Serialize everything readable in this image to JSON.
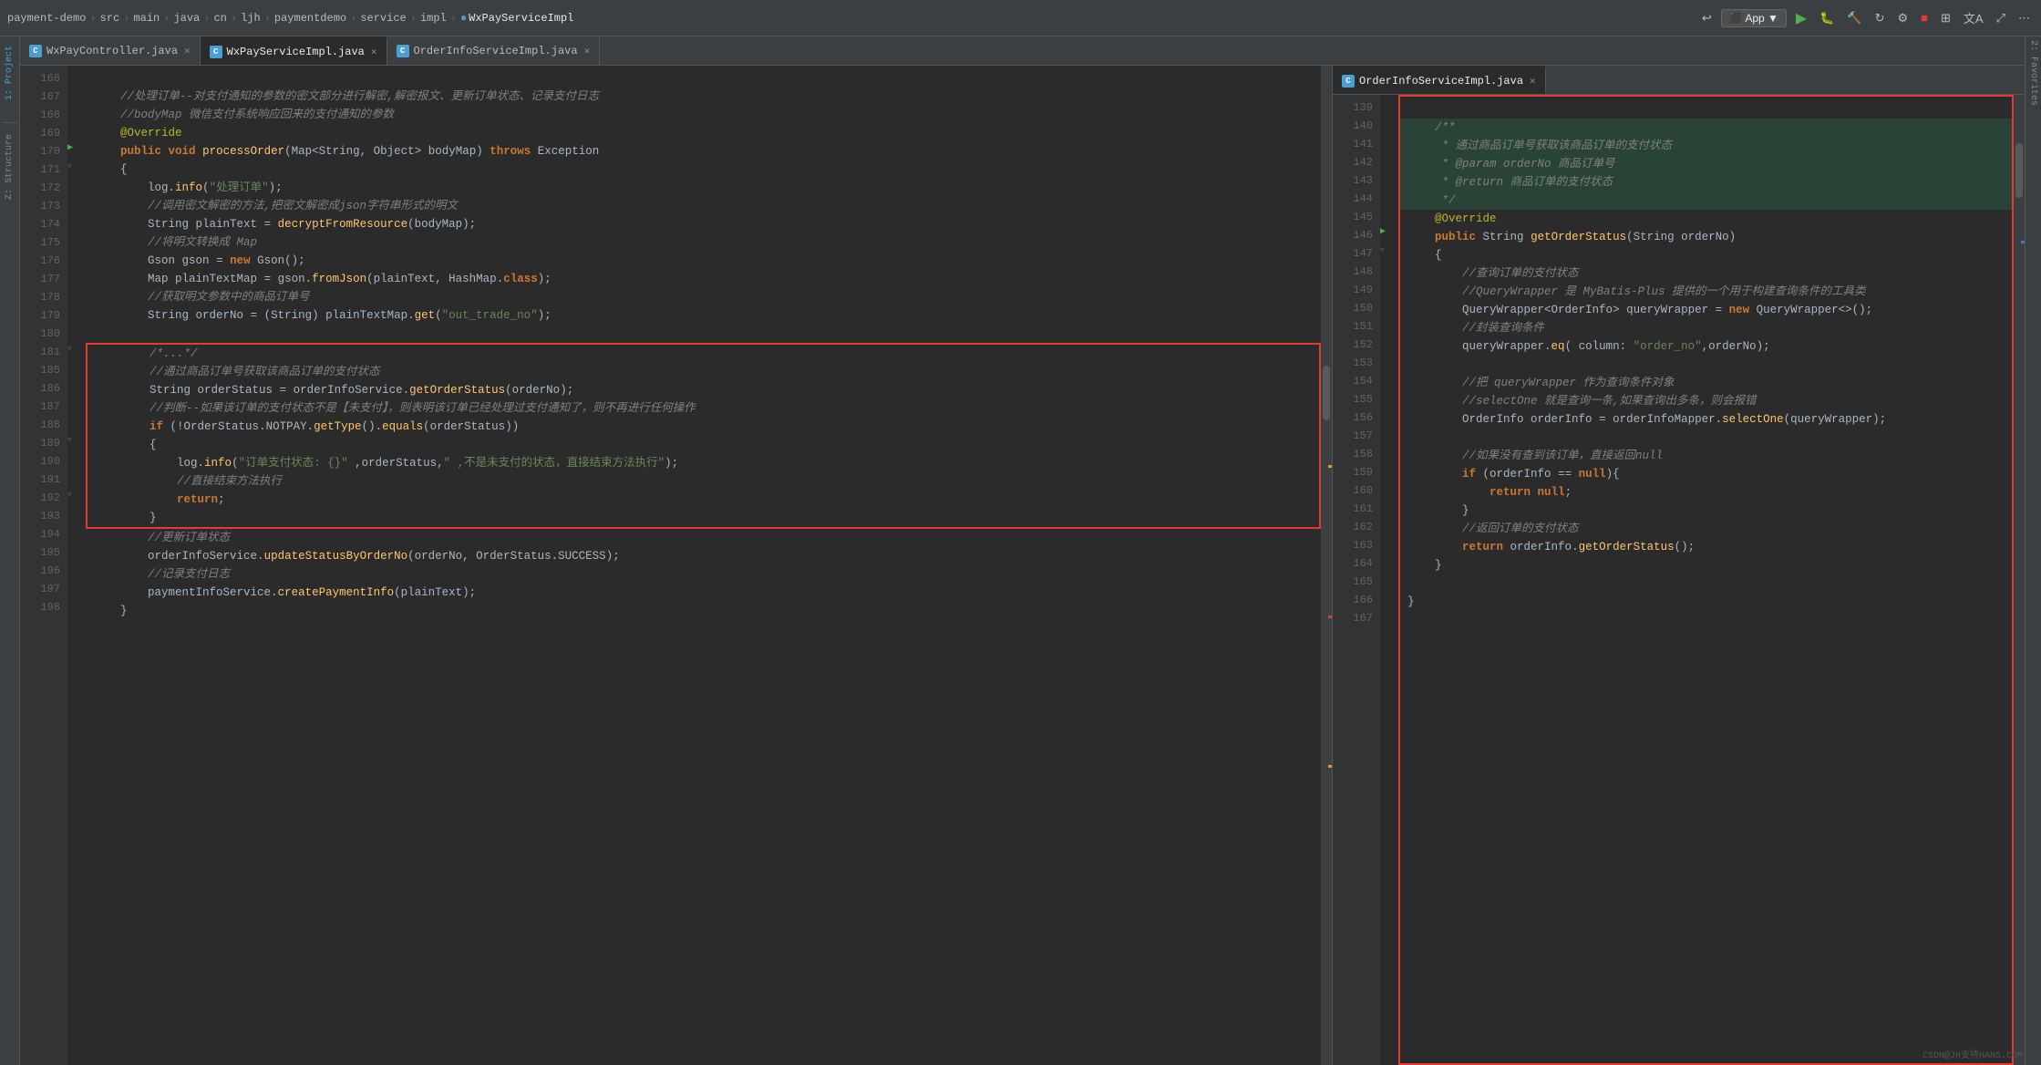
{
  "titleBar": {
    "breadcrumb": [
      "payment-demo",
      "src",
      "main",
      "java",
      "cn",
      "ljh",
      "paymentdemo",
      "service",
      "impl",
      "WxPayServiceImpl"
    ],
    "appLabel": "App",
    "buttons": [
      "run",
      "debug",
      "build",
      "reload",
      "settings",
      "stop",
      "structure",
      "translate",
      "expand",
      "settings2"
    ]
  },
  "leftTabs": [
    {
      "label": "WxPayController.java",
      "active": false
    },
    {
      "label": "WxPayServiceImpl.java",
      "active": true
    },
    {
      "label": "OrderInfoServiceImpl.java",
      "active": false
    }
  ],
  "rightTabs": [
    {
      "label": "OrderInfoServiceImpl.java",
      "active": true
    }
  ],
  "leftCode": {
    "startLine": 166,
    "lines": [
      {
        "n": 166,
        "content": ""
      },
      {
        "n": 167,
        "content": "    <cm>//处理订单--对支付通知的参数的密文部分进行解密,解密报文、更新订单状态、记录支付日志</cm>",
        "comment": true
      },
      {
        "n": 168,
        "content": "    <cm>//bodyMap 微信支付系统响应回来的支付通知的参数</cm>",
        "comment": true
      },
      {
        "n": 169,
        "content": "    <ann>@Override</ann>"
      },
      {
        "n": 170,
        "content": "    <kw>public</kw> <kw>void</kw> <fn>processOrder</fn>(<cls>Map</cls>&lt;<cls>String</cls>, <cls>Object</cls>&gt; <var>bodyMap</var>) <kw>throws</kw> <cls>Exception</cls>",
        "hasIcon": true
      },
      {
        "n": 171,
        "content": "    {"
      },
      {
        "n": 172,
        "content": "        <fn>log</fn>.<fn>info</fn>(<str>\"处理订单\"</str>);"
      },
      {
        "n": 173,
        "content": "        <cm>//调用密文解密的方法,把密文解密成json字符串形式的明文</cm>",
        "comment": true
      },
      {
        "n": 174,
        "content": "        <cls>String</cls> <var>plainText</var> = <fn>decryptFromResource</fn>(<var>bodyMap</var>);"
      },
      {
        "n": 175,
        "content": "        <cm>//将明文转换成 Map</cm>",
        "comment": true
      },
      {
        "n": 176,
        "content": "        <cls>Gson</cls> <var>gson</var> = <kw>new</kw> <cls>Gson</cls>();"
      },
      {
        "n": 177,
        "content": "        <cls>Map</cls> <var>plainTextMap</var> = <var>gson</var>.<fn>fromJson</fn>(<var>plainText</var>, <cls>HashMap</cls>.<kw>class</kw>);"
      },
      {
        "n": 178,
        "content": "        <cm>//获取明文参数中的商品订单号</cm>",
        "comment": true
      },
      {
        "n": 179,
        "content": "        <cls>String</cls> <var>orderNo</var> = (<cls>String</cls>) <var>plainTextMap</var>.<fn>get</fn>(<str>\"out_trade_no\"</str>);"
      },
      {
        "n": 180,
        "content": ""
      }
    ]
  },
  "leftCodeBox": {
    "lines": [
      {
        "n": 181,
        "content": "        <cm>/*...*/</cm>"
      },
      {
        "n": 185,
        "content": "        <cm>//通过商品订单号获取该商品订单的支付状态</cm>"
      },
      {
        "n": 186,
        "content": "        <cls>String</cls> <var>orderStatus</var> = <var>orderInfoService</var>.<fn>getOrderStatus</fn>(<var>orderNo</var>);"
      },
      {
        "n": 187,
        "content": "        <cm>//判断--如果该订单的支付状态不是【未支付】,则表明该订单已经处理过支付通知了,则不再进行任何操作</cm>"
      },
      {
        "n": 188,
        "content": "        <kw>if</kw> (!<cls>OrderStatus</cls>.<var>NOTPAY</var>.<fn>getType</fn>().<fn>equals</fn>(<var>orderStatus</var>))"
      },
      {
        "n": 189,
        "content": "        {"
      },
      {
        "n": 190,
        "content": "            <fn>log</fn>.<fn>info</fn>(<str>\"订单支付状态: {}\"</str> ,<var>orderStatus</var>,<str>\"  ,不是未支付的状态，直接结束方法执行\"</str>);"
      },
      {
        "n": 191,
        "content": "            <cm>//直接结束方法执行</cm>"
      },
      {
        "n": 192,
        "content": "            <kw>return</kw>;"
      },
      {
        "n": 193,
        "content": "        }"
      }
    ]
  },
  "leftCodeAfterBox": {
    "lines": [
      {
        "n": 194,
        "content": "        <cm>//更新订单状态</cm>"
      },
      {
        "n": 195,
        "content": "        <var>orderInfoService</var>.<fn>updateStatusByOrderNo</fn>(<var>orderNo</var>, <cls>OrderStatus</cls>.<var>SUCCESS</var>);"
      },
      {
        "n": 196,
        "content": "        <cm>//记录支付日志</cm>"
      },
      {
        "n": 197,
        "content": "        <var>paymentInfoService</var>.<fn>createPaymentInfo</fn>(<var>plainText</var>);"
      },
      {
        "n": 198,
        "content": "    }"
      }
    ]
  },
  "rightCode": {
    "startLine": 139,
    "headerLines": [
      {
        "n": 139,
        "content": ""
      },
      {
        "n": 140,
        "content": "    <cm>/**</cm>",
        "hl": "green"
      },
      {
        "n": 141,
        "content": "     <cm>* 通过商品订单号获取该商品订单的支付状态</cm>",
        "hl": "green"
      },
      {
        "n": 142,
        "content": "     <cm>* @param orderNo  商品订单号</cm>",
        "hl": "green"
      },
      {
        "n": 143,
        "content": "     <cm>* @return 商品订单的支付状态</cm>",
        "hl": "green"
      },
      {
        "n": 144,
        "content": "     <cm>*/</cm>",
        "hl": "green"
      },
      {
        "n": 145,
        "content": "    <ann>@Override</ann>"
      },
      {
        "n": 146,
        "content": "    <kw>public</kw> <cls>String</cls> <fn>getOrderStatus</fn>(<cls>String</cls> <var>orderNo</var>)",
        "hasIcon": true
      },
      {
        "n": 147,
        "content": "    {"
      },
      {
        "n": 148,
        "content": "        <cm>//查询订单的支付状态</cm>"
      },
      {
        "n": 149,
        "content": "        <cm>//QueryWrapper 是 MyBatis-Plus 提供的一个用于构建查询条件的工具类</cm>"
      },
      {
        "n": 150,
        "content": "        <cls>QueryWrapper</cls>&lt;<cls>OrderInfo</cls>&gt; <var>queryWrapper</var> = <kw>new</kw> <cls>QueryWrapper</cls>&lt;&gt;();"
      },
      {
        "n": 151,
        "content": "        <cm>//封装查询条件</cm>"
      },
      {
        "n": 152,
        "content": "        <var>queryWrapper</var>.<fn>eq</fn>( column: <str>\"order_no\"</str>,<var>orderNo</var>);"
      },
      {
        "n": 153,
        "content": ""
      },
      {
        "n": 154,
        "content": "        <cm>//把 queryWrapper 作为查询条件对象</cm>"
      },
      {
        "n": 155,
        "content": "        <cm>//selectOne 就是查询一条,如果查询出多条，则会报错</cm>"
      },
      {
        "n": 156,
        "content": "        <cls>OrderInfo</cls> <var>orderInfo</var> = <var>orderInfoMapper</var>.<fn>selectOne</fn>(<var>queryWrapper</var>);"
      },
      {
        "n": 157,
        "content": ""
      },
      {
        "n": 158,
        "content": "        <cm>//如果没有查到该订单，直接返回null</cm>"
      },
      {
        "n": 159,
        "content": "        <kw>if</kw> (<var>orderInfo</var> == <kw>null</kw>){"
      },
      {
        "n": 160,
        "content": "            <kw>return</kw> <kw>null</kw>;"
      },
      {
        "n": 161,
        "content": "        }"
      },
      {
        "n": 162,
        "content": "        <cm>//返回订单的支付状态</cm>"
      },
      {
        "n": 163,
        "content": "        <kw>return</kw> <var>orderInfo</var>.<fn>getOrderStatus</fn>();"
      },
      {
        "n": 164,
        "content": "    }"
      },
      {
        "n": 165,
        "content": ""
      },
      {
        "n": 166,
        "content": "}"
      },
      {
        "n": 167,
        "content": ""
      }
    ]
  },
  "watermark": "CSDN@JH支持HANS.COM"
}
